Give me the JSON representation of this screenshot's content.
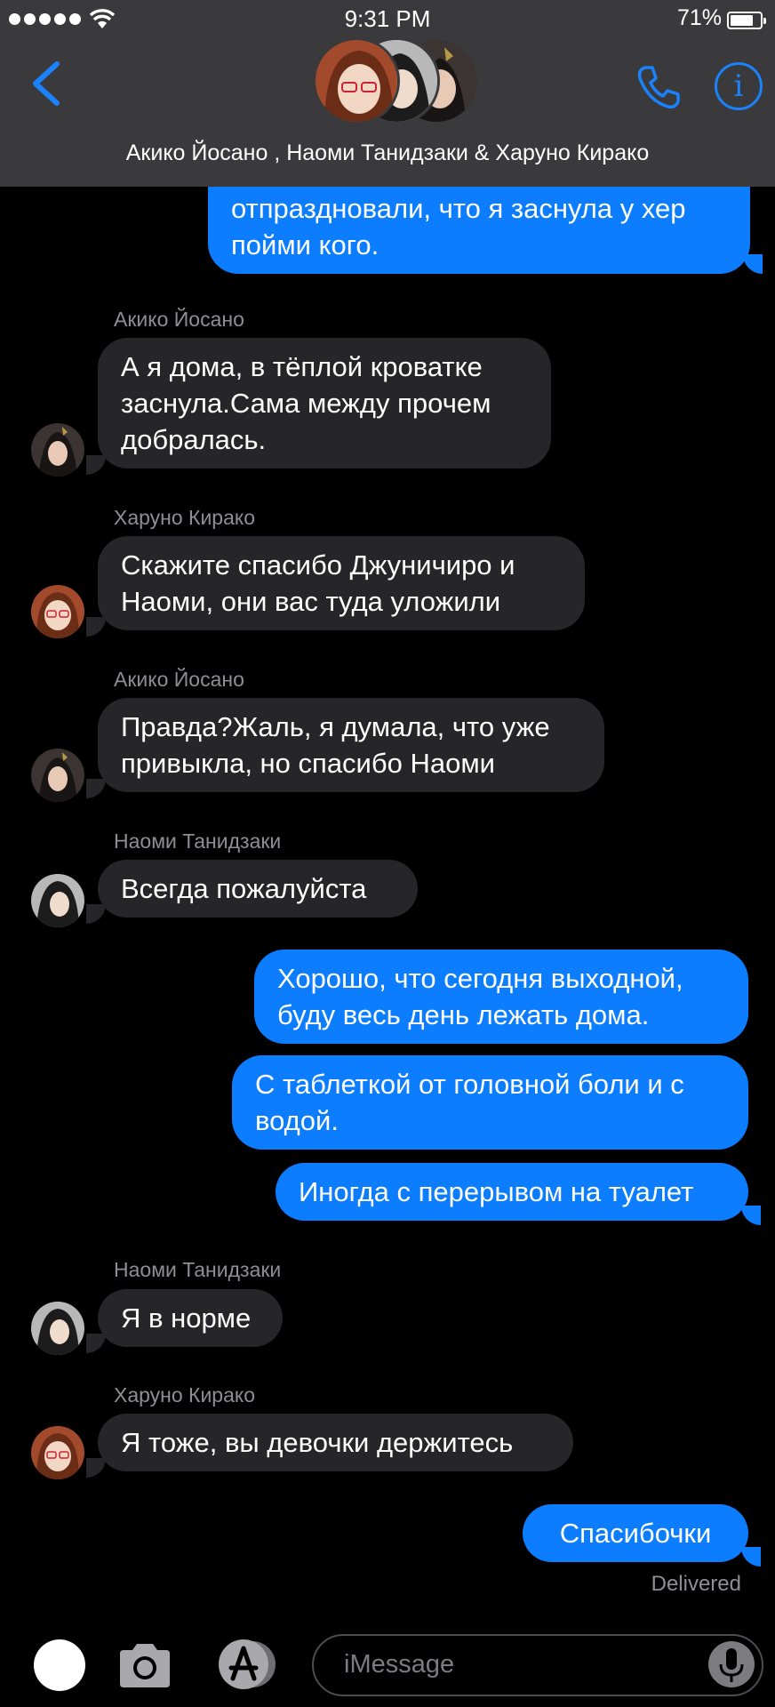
{
  "status": {
    "time": "9:31 PM",
    "battery": "71%"
  },
  "header": {
    "title": "Акико Йосано , Наоми Танидзаки & Харуно Кирако"
  },
  "messages": {
    "m0": "отпраздновали, что я заснула у хер пойми кого.",
    "s1": "Акико Йосано",
    "m1": "А я дома, в тёплой кроватке заснула.Сама между прочем добралась.",
    "s2": "Харуно Кирако",
    "m2": "Скажите спасибо Джуничиро и Наоми, они вас туда уложили",
    "s3": "Акико Йосано",
    "m3": "Правда?Жаль, я думала, что уже привыкла, но спасибо Наоми",
    "s4": "Наоми Танидзаки",
    "m4": "Всегда пожалуйста",
    "m5": "Хорошо, что сегодня выходной, буду весь день лежать дома.",
    "m6": "С таблеткой от головной боли и с водой.",
    "m7": "Иногда с перерывом на туалет",
    "s8": "Наоми Танидзаки",
    "m8": "Я в норме",
    "s9": "Харуно Кирако",
    "m9": "Я тоже, вы девочки держитесь",
    "m10": "Спасибочки",
    "delivered": "Delivered"
  },
  "input": {
    "placeholder": "iMessage"
  },
  "colors": {
    "accent": "#0b7dfe",
    "incoming": "#262629",
    "header": "#3a3a3c"
  },
  "icons": [
    "back-chevron-icon",
    "phone-icon",
    "info-icon",
    "camera-icon",
    "app-store-icon",
    "microphone-icon"
  ]
}
